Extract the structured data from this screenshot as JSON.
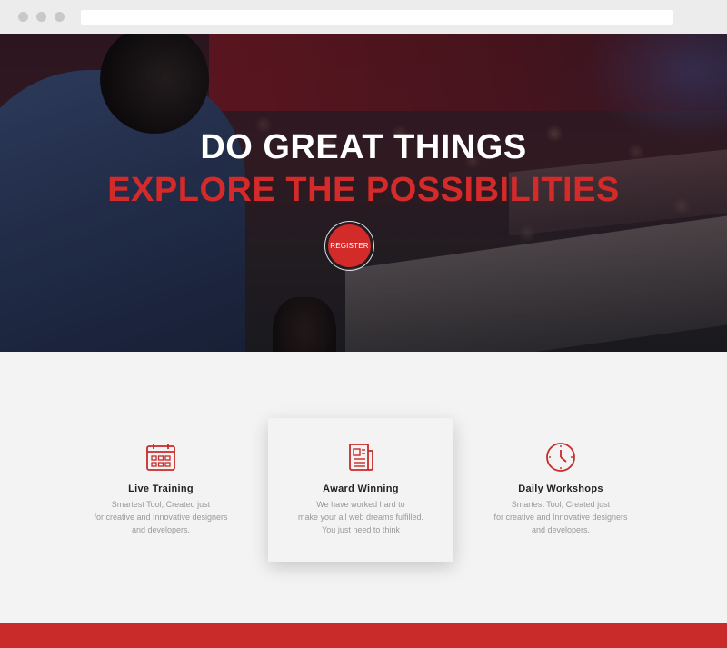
{
  "hero": {
    "line1": "DO GREAT THINGS",
    "line2": "EXPLORE THE POSSIBILITIES",
    "register_label": "REGISTER"
  },
  "features": [
    {
      "icon": "calendar-icon",
      "title": "Live Training",
      "lines": [
        "Smartest Tool, Created just",
        "for creative and Innovative designers",
        "and developers."
      ]
    },
    {
      "icon": "document-icon",
      "title": "Award Winning",
      "lines": [
        "We have worked hard to",
        "make your all web dreams fulfilled.",
        "You just need to think"
      ]
    },
    {
      "icon": "clock-icon",
      "title": "Daily Workshops",
      "lines": [
        "Smartest Tool, Created just",
        "for creative and Innovative designers",
        "and developers."
      ]
    }
  ],
  "colors": {
    "accent": "#d32a2a",
    "background": "#f3f3f3",
    "footer": "#c92a2a"
  }
}
